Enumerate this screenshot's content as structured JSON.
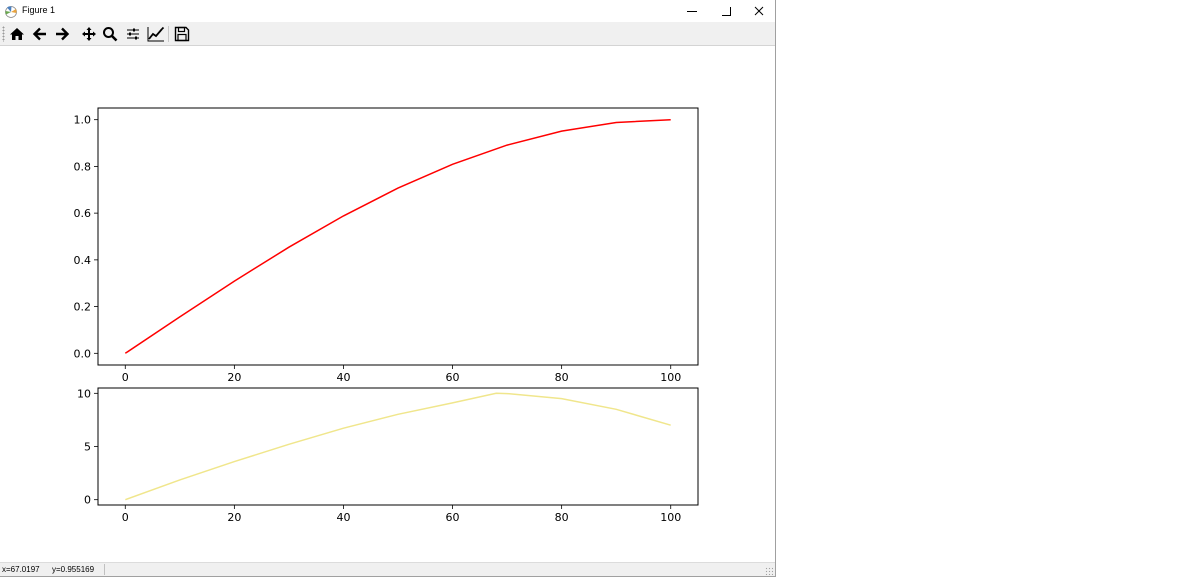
{
  "window": {
    "title": "Figure 1"
  },
  "toolbar": {
    "buttons": [
      "home-icon",
      "back-icon",
      "forward-icon",
      "pan-icon",
      "zoom-icon",
      "subplots-icon",
      "edit-curves-icon",
      "save-icon"
    ]
  },
  "status": {
    "x": "x=67.0197",
    "y": "y=0.955169"
  },
  "colors": {
    "line1": "#ff0000",
    "line2": "#f0e68c"
  },
  "chart_data": [
    {
      "type": "line",
      "title": "",
      "xlabel": "",
      "ylabel": "",
      "xlim": [
        -5,
        105
      ],
      "ylim": [
        -0.05,
        1.05
      ],
      "xticks": [
        0,
        20,
        40,
        60,
        80,
        100
      ],
      "yticks": [
        0.0,
        0.2,
        0.4,
        0.6,
        0.8,
        1.0
      ],
      "xtick_labels": [
        "0",
        "20",
        "40",
        "60",
        "80",
        "100"
      ],
      "ytick_labels": [
        "0.0",
        "0.2",
        "0.4",
        "0.6",
        "0.8",
        "1.0"
      ],
      "grid": false,
      "series": [
        {
          "color": "#ff0000",
          "x": [
            0,
            10,
            20,
            30,
            40,
            50,
            60,
            70,
            80,
            90,
            100
          ],
          "y": [
            0.0,
            0.156,
            0.309,
            0.454,
            0.588,
            0.707,
            0.809,
            0.891,
            0.951,
            0.988,
            1.0
          ]
        }
      ]
    },
    {
      "type": "line",
      "title": "",
      "xlabel": "",
      "ylabel": "",
      "xlim": [
        -5,
        105
      ],
      "ylim": [
        -0.5,
        10.5
      ],
      "xticks": [
        0,
        20,
        40,
        60,
        80,
        100
      ],
      "yticks": [
        0,
        5,
        10
      ],
      "xtick_labels": [
        "0",
        "20",
        "40",
        "60",
        "80",
        "100"
      ],
      "ytick_labels": [
        "0",
        "5",
        "10"
      ],
      "grid": false,
      "series": [
        {
          "color": "#f0e68c",
          "x": [
            0,
            10,
            20,
            30,
            40,
            50,
            60,
            68,
            70,
            80,
            90,
            100
          ],
          "y": [
            0.0,
            1.86,
            3.58,
            5.21,
            6.72,
            8.03,
            9.1,
            10.0,
            9.97,
            9.5,
            8.5,
            7.0
          ]
        }
      ]
    }
  ]
}
